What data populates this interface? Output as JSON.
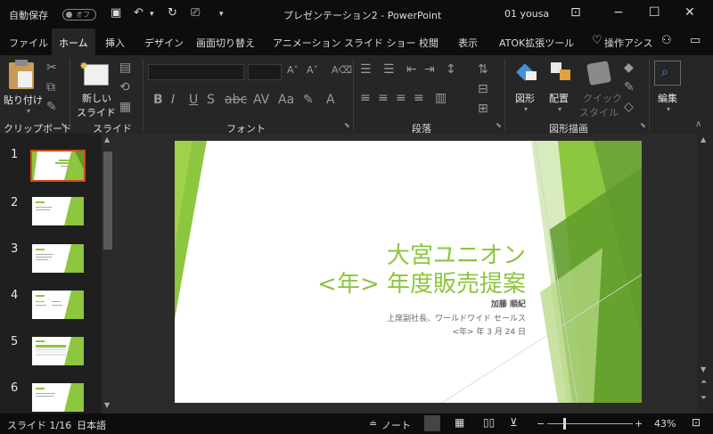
{
  "titlebar": {
    "autosave_label": "自動保存",
    "autosave_state": "オフ",
    "doc_title": "プレゼンテーション2  -  PowerPoint",
    "user": "01 yousa"
  },
  "tabs": [
    "ファイル",
    "ホーム",
    "挿入",
    "デザイン",
    "画面切り替え",
    "アニメーション",
    "スライド ショー",
    "校閲",
    "表示",
    "ATOK拡張ツール",
    "操作アシス"
  ],
  "ribbon": {
    "paste": "貼り付け",
    "new_slide_1": "新しい",
    "new_slide_2": "スライド",
    "shapes": "図形",
    "arrange": "配置",
    "quick_1": "クイック",
    "quick_2": "スタイル",
    "edit": "編集",
    "groups": {
      "clipboard": "クリップボード",
      "slide": "スライド",
      "font": "フォント",
      "paragraph": "段落",
      "drawing": "図形描画"
    }
  },
  "thumbnails": [
    "1",
    "2",
    "3",
    "4",
    "5",
    "6"
  ],
  "slide": {
    "title_line1": "大宮ユニオン",
    "title_line2": "<年> 年度販売提案",
    "author": "加藤 順紀",
    "position": "上席副社長、ワールドワイド セールス",
    "date": "<年> 年 3 月 24 日"
  },
  "statusbar": {
    "slide_count": "スライド 1/16",
    "language": "日本語",
    "notes": "ノート",
    "zoom": "43%"
  },
  "colors": {
    "accent": "#8dc63f",
    "accent_dark": "#5f9b2b",
    "thumb_selected": "#d44a1a"
  }
}
